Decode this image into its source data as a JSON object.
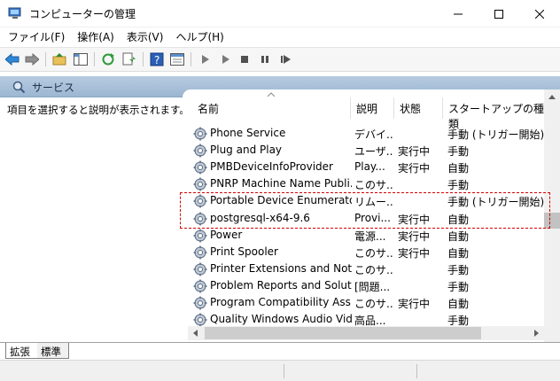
{
  "window": {
    "title": "コンピューターの管理"
  },
  "menu": [
    "ファイル(F)",
    "操作(A)",
    "表示(V)",
    "ヘルプ(H)"
  ],
  "section": {
    "title": "サービス"
  },
  "description_hint": "項目を選択すると説明が表示されます。",
  "columns": {
    "name": "名前",
    "description": "説明",
    "state": "状態",
    "startup": "スタートアップの種類"
  },
  "services": [
    {
      "name": "Phone Service",
      "description": "デバイ...",
      "state": "",
      "startup": "手動 (トリガー開始)"
    },
    {
      "name": "Plug and Play",
      "description": "ユーザ...",
      "state": "実行中",
      "startup": "手動"
    },
    {
      "name": "PMBDeviceInfoProvider",
      "description": "Play...",
      "state": "実行中",
      "startup": "自動"
    },
    {
      "name": "PNRP Machine Name Publi...",
      "description": "このサ...",
      "state": "",
      "startup": "手動"
    },
    {
      "name": "Portable Device Enumerator...",
      "description": "リムー...",
      "state": "",
      "startup": "手動 (トリガー開始)"
    },
    {
      "name": "postgresql-x64-9.6",
      "description": "Provi...",
      "state": "実行中",
      "startup": "自動"
    },
    {
      "name": "Power",
      "description": "電源...",
      "state": "実行中",
      "startup": "自動"
    },
    {
      "name": "Print Spooler",
      "description": "このサ...",
      "state": "実行中",
      "startup": "自動"
    },
    {
      "name": "Printer Extensions and Notif...",
      "description": "このサ...",
      "state": "",
      "startup": "手動"
    },
    {
      "name": "Problem Reports and Soluti...",
      "description": "[問題...",
      "state": "",
      "startup": "手動"
    },
    {
      "name": "Program Compatibility Assis...",
      "description": "このサ...",
      "state": "実行中",
      "startup": "自動"
    },
    {
      "name": "Quality Windows Audio Vid...",
      "description": "高品...",
      "state": "",
      "startup": "手動"
    }
  ],
  "tabs": {
    "extended": "拡張",
    "standard": "標準"
  },
  "icons": [
    "back-icon",
    "forward-icon",
    "up-folder-icon",
    "show-hide-tree-icon",
    "refresh-icon",
    "export-list-icon",
    "help-icon",
    "properties-icon",
    "play-icon",
    "play-alt-icon",
    "stop-icon",
    "pause-icon",
    "restart-icon"
  ]
}
